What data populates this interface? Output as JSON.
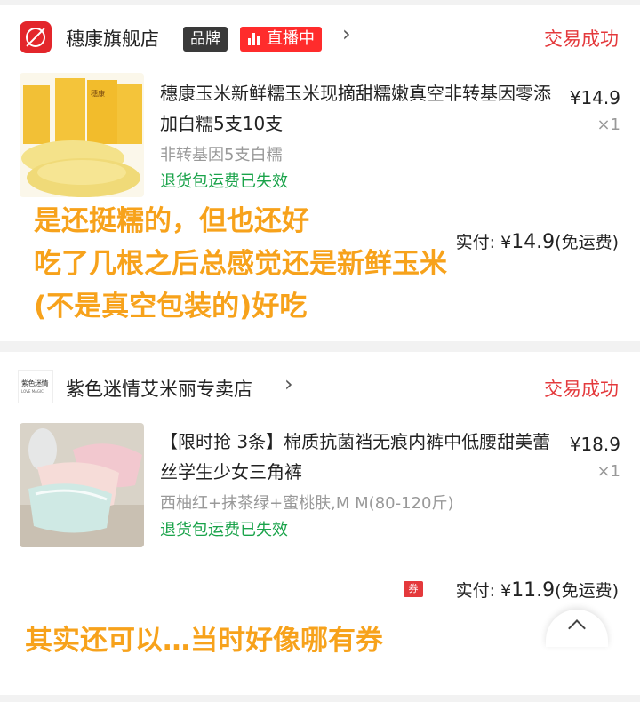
{
  "orders": [
    {
      "shop_name": "穗康旗舰店",
      "badge_brand": "品牌",
      "badge_live": "直播中",
      "status": "交易成功",
      "product_title": "穗康玉米新鲜糯玉米现摘甜糯嫩真空非转基因零添加白糯5支10支",
      "price": "¥14.9",
      "quantity": "×1",
      "spec": "非转基因5支白糯",
      "refund_note": "退货包运费已失效",
      "paid_label": "实付: ¥",
      "paid_amount": "14.9",
      "shipping_note": "(免运费)",
      "package_text": "穗康"
    },
    {
      "shop_name": "紫色迷情艾米丽专卖店",
      "shop_logo_text": "紫色迷情",
      "shop_logo_sub": "LOVE MAGIC",
      "status": "交易成功",
      "product_title": "【限时抢 3条】棉质抗菌裆无痕内裤中低腰甜美蕾丝学生少女三角裤",
      "price": "¥18.9",
      "quantity": "×1",
      "spec": "西柚红+抹茶绿+蜜桃肤,M M(80-120斤)",
      "refund_note": "退货包运费已失效",
      "coupon_label": "券",
      "paid_label": "实付: ¥",
      "paid_amount": "11.9",
      "shipping_note": "(免运费)"
    }
  ],
  "annotations": {
    "comment1_line1": "是还挺糯的，但也还好",
    "comment1_line2": "吃了几根之后总感觉还是新鲜玉米",
    "comment1_line3": "(不是真空包装的)好吃",
    "comment2": "其实还可以…当时好像哪有券"
  },
  "colors": {
    "accent": "#e4393c",
    "live": "#ff2c2c",
    "success_green": "#1aa34a",
    "overlay_orange": "#f7a21b"
  }
}
